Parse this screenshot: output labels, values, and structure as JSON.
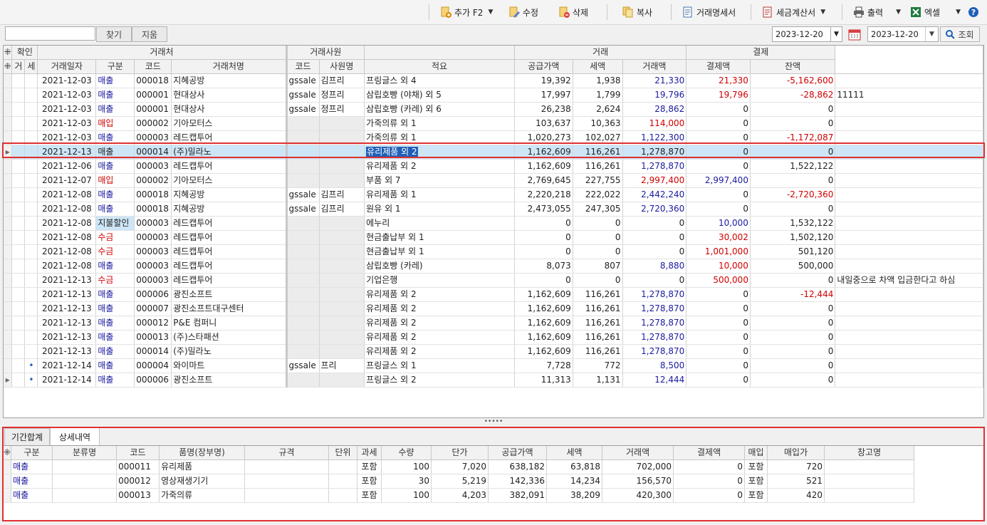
{
  "toolbar": {
    "add": "추가 F2",
    "edit": "수정",
    "delete": "삭제",
    "copy": "복사",
    "statement": "거래명세서",
    "invoice": "세금계산서",
    "print": "출력",
    "excel": "엑셀"
  },
  "search": {
    "find": "찾기",
    "clear": "지움",
    "date_from": "2023-12-20",
    "date_to": "2023-12-20",
    "query": "조회"
  },
  "grid": {
    "groups": {
      "confirm": "확인",
      "partner": "거래처",
      "staff": "거래사원",
      "trade": "거래",
      "settle": "결제"
    },
    "headers": {
      "g1": "거",
      "g2": "세",
      "date": "거래일자",
      "kind": "구분",
      "code": "코드",
      "name": "거래처명",
      "scode": "코드",
      "sname": "사원명",
      "memo": "적요",
      "supply": "공급가액",
      "tax": "세액",
      "amount": "거래액",
      "paid": "결제액",
      "balance": "잔액"
    },
    "rows": [
      {
        "m": "",
        "dot": "",
        "date": "2021-12-03",
        "kind": "매출",
        "kc": "blue",
        "code": "000018",
        "name": "지혜공방",
        "sc": "gssale",
        "sn": "김프리",
        "memo": "프링글스 외 4",
        "supply": "19,392",
        "tax": "1,938",
        "amount": "21,330",
        "paid": "21,330",
        "pc": "red",
        "bal": "-5,162,600",
        "bc": "red",
        "note": ""
      },
      {
        "m": "",
        "dot": "",
        "date": "2021-12-03",
        "kind": "매출",
        "kc": "blue",
        "code": "000001",
        "name": "현대상사",
        "sc": "gssale",
        "sn": "정프리",
        "memo": "삼립호빵 (야채) 외 5",
        "supply": "17,997",
        "tax": "1,799",
        "amount": "19,796",
        "paid": "19,796",
        "pc": "red",
        "bal": "-28,862",
        "bc": "red",
        "note": "11111"
      },
      {
        "m": "",
        "dot": "",
        "date": "2021-12-03",
        "kind": "매출",
        "kc": "blue",
        "code": "000001",
        "name": "현대상사",
        "sc": "gssale",
        "sn": "정프리",
        "memo": "삼립호빵 (카레) 외 6",
        "supply": "26,238",
        "tax": "2,624",
        "amount": "28,862",
        "paid": "0",
        "pc": "",
        "bal": "0",
        "bc": "",
        "note": ""
      },
      {
        "m": "",
        "dot": "",
        "date": "2021-12-03",
        "kind": "매입",
        "kc": "red",
        "code": "000002",
        "name": "기아모터스",
        "sc": "",
        "sn": "",
        "memo": "가죽의류 외 1",
        "supply": "103,637",
        "tax": "10,363",
        "amount": "114,000",
        "ac": "red",
        "paid": "0",
        "pc": "",
        "bal": "0",
        "bc": "",
        "note": ""
      },
      {
        "m": "",
        "dot": "",
        "date": "2021-12-03",
        "kind": "매출",
        "kc": "blue",
        "code": "000003",
        "name": "레드캡투어",
        "sc": "",
        "sn": "",
        "memo": "가죽의류 외 1",
        "supply": "1,020,273",
        "tax": "102,027",
        "amount": "1,122,300",
        "paid": "0",
        "pc": "",
        "bal": "-1,172,087",
        "bc": "red",
        "note": ""
      },
      {
        "m": "▸",
        "dot": "",
        "date": "2021-12-13",
        "kind": "매출",
        "kc": "",
        "code": "000014",
        "name": "(주)밀라노",
        "sc": "",
        "sn": "",
        "memo": "유리제품 외 2",
        "supply": "1,162,609",
        "tax": "116,261",
        "amount": "1,278,870",
        "ac": "plain",
        "paid": "0",
        "pc": "",
        "bal": "0",
        "bc": "",
        "note": "",
        "sel": true
      },
      {
        "m": "",
        "dot": "",
        "date": "2021-12-06",
        "kind": "매출",
        "kc": "blue",
        "code": "000003",
        "name": "레드캡투어",
        "sc": "",
        "sn": "",
        "memo": "유리제품 외 2",
        "supply": "1,162,609",
        "tax": "116,261",
        "amount": "1,278,870",
        "paid": "0",
        "pc": "",
        "bal": "1,522,122",
        "bc": "",
        "note": ""
      },
      {
        "m": "",
        "dot": "",
        "date": "2021-12-07",
        "kind": "매입",
        "kc": "red",
        "code": "000002",
        "name": "기아모터스",
        "sc": "",
        "sn": "",
        "memo": "부품 외 7",
        "supply": "2,769,645",
        "tax": "227,755",
        "amount": "2,997,400",
        "ac": "red",
        "paid": "2,997,400",
        "pc": "blue",
        "bal": "0",
        "bc": "",
        "note": ""
      },
      {
        "m": "",
        "dot": "",
        "date": "2021-12-08",
        "kind": "매출",
        "kc": "blue",
        "code": "000018",
        "name": "지혜공방",
        "sc": "gssale",
        "sn": "김프리",
        "memo": "유리제품 외 1",
        "supply": "2,220,218",
        "tax": "222,022",
        "amount": "2,442,240",
        "paid": "0",
        "pc": "",
        "bal": "-2,720,360",
        "bc": "red",
        "note": ""
      },
      {
        "m": "",
        "dot": "",
        "date": "2021-12-08",
        "kind": "매출",
        "kc": "blue",
        "code": "000018",
        "name": "지혜공방",
        "sc": "gssale",
        "sn": "김프리",
        "memo": "원유 외 1",
        "supply": "2,473,055",
        "tax": "247,305",
        "amount": "2,720,360",
        "paid": "0",
        "pc": "",
        "bal": "0",
        "bc": "",
        "note": ""
      },
      {
        "m": "",
        "dot": "",
        "date": "2021-12-08",
        "kind": "지불할인",
        "kc": "hl",
        "code": "000003",
        "name": "레드캡투어",
        "sc": "",
        "sn": "",
        "memo": "에누리",
        "supply": "0",
        "tax": "0",
        "amount": "0",
        "ac": "plain",
        "paid": "10,000",
        "pc": "blue",
        "bal": "1,532,122",
        "bc": "",
        "note": ""
      },
      {
        "m": "",
        "dot": "",
        "date": "2021-12-08",
        "kind": "수금",
        "kc": "red",
        "code": "000003",
        "name": "레드캡투어",
        "sc": "",
        "sn": "",
        "memo": "현금출납부 외 1",
        "supply": "0",
        "tax": "0",
        "amount": "0",
        "ac": "plain",
        "paid": "30,002",
        "pc": "red",
        "bal": "1,502,120",
        "bc": "",
        "note": ""
      },
      {
        "m": "",
        "dot": "",
        "date": "2021-12-08",
        "kind": "수금",
        "kc": "red",
        "code": "000003",
        "name": "레드캡투어",
        "sc": "",
        "sn": "",
        "memo": "현금출납부 외 1",
        "supply": "0",
        "tax": "0",
        "amount": "0",
        "ac": "plain",
        "paid": "1,001,000",
        "pc": "red",
        "bal": "501,120",
        "bc": "",
        "note": ""
      },
      {
        "m": "",
        "dot": "",
        "date": "2021-12-08",
        "kind": "매출",
        "kc": "blue",
        "code": "000003",
        "name": "레드캡투어",
        "sc": "",
        "sn": "",
        "memo": "삼립호빵 (카레)",
        "supply": "8,073",
        "tax": "807",
        "amount": "8,880",
        "paid": "10,000",
        "pc": "red",
        "bal": "500,000",
        "bc": "",
        "note": ""
      },
      {
        "m": "",
        "dot": "",
        "date": "2021-12-13",
        "kind": "수금",
        "kc": "red",
        "code": "000003",
        "name": "레드캡투어",
        "sc": "",
        "sn": "",
        "memo": "기업은행",
        "supply": "0",
        "tax": "0",
        "amount": "0",
        "ac": "plain",
        "paid": "500,000",
        "pc": "red",
        "bal": "0",
        "bc": "",
        "note": "내일중으로 차액 입금한다고 하심"
      },
      {
        "m": "",
        "dot": "",
        "date": "2021-12-13",
        "kind": "매출",
        "kc": "blue",
        "code": "000006",
        "name": "광진소프트",
        "sc": "",
        "sn": "",
        "memo": "유리제품 외 2",
        "supply": "1,162,609",
        "tax": "116,261",
        "amount": "1,278,870",
        "paid": "0",
        "pc": "",
        "bal": "-12,444",
        "bc": "red",
        "note": ""
      },
      {
        "m": "",
        "dot": "",
        "date": "2021-12-13",
        "kind": "매출",
        "kc": "blue",
        "code": "000007",
        "name": "광진소프트대구센터",
        "sc": "",
        "sn": "",
        "memo": "유리제품 외 2",
        "supply": "1,162,609",
        "tax": "116,261",
        "amount": "1,278,870",
        "paid": "0",
        "pc": "",
        "bal": "0",
        "bc": "",
        "note": ""
      },
      {
        "m": "",
        "dot": "",
        "date": "2021-12-13",
        "kind": "매출",
        "kc": "blue",
        "code": "000012",
        "name": "P&E 컴퍼니",
        "sc": "",
        "sn": "",
        "memo": "유리제품 외 2",
        "supply": "1,162,609",
        "tax": "116,261",
        "amount": "1,278,870",
        "paid": "0",
        "pc": "",
        "bal": "0",
        "bc": "",
        "note": ""
      },
      {
        "m": "",
        "dot": "",
        "date": "2021-12-13",
        "kind": "매출",
        "kc": "blue",
        "code": "000013",
        "name": "(주)스타패션",
        "sc": "",
        "sn": "",
        "memo": "유리제품 외 2",
        "supply": "1,162,609",
        "tax": "116,261",
        "amount": "1,278,870",
        "paid": "0",
        "pc": "",
        "bal": "0",
        "bc": "",
        "note": ""
      },
      {
        "m": "",
        "dot": "",
        "date": "2021-12-13",
        "kind": "매출",
        "kc": "blue",
        "code": "000014",
        "name": "(주)밀라노",
        "sc": "",
        "sn": "",
        "memo": "유리제품 외 2",
        "supply": "1,162,609",
        "tax": "116,261",
        "amount": "1,278,870",
        "paid": "0",
        "pc": "",
        "bal": "0",
        "bc": "",
        "note": ""
      },
      {
        "m": "",
        "dot": "•",
        "date": "2021-12-14",
        "kind": "매출",
        "kc": "blue",
        "code": "000004",
        "name": "와이마트",
        "sc": "gssale",
        "sn": "프리",
        "memo": "프링글스 외 1",
        "supply": "7,728",
        "tax": "772",
        "amount": "8,500",
        "paid": "0",
        "pc": "",
        "bal": "0",
        "bc": "",
        "note": ""
      },
      {
        "m": "▸",
        "dot": "•",
        "date": "2021-12-14",
        "kind": "매출",
        "kc": "blue",
        "code": "000006",
        "name": "광진소프트",
        "sc": "",
        "sn": "",
        "memo": "프링글스 외 2",
        "supply": "11,313",
        "tax": "1,131",
        "amount": "12,444",
        "paid": "0",
        "pc": "",
        "bal": "0",
        "bc": "",
        "note": ""
      }
    ]
  },
  "bottom": {
    "tabs": [
      "기간합계",
      "상세내역"
    ],
    "headers": {
      "kind": "구분",
      "cat": "분류명",
      "code": "코드",
      "item": "품명(장부명)",
      "spec": "규격",
      "unit": "단위",
      "taxable": "과세",
      "qty": "수량",
      "price": "단가",
      "supply": "공급가액",
      "tax": "세액",
      "amount": "거래액",
      "paid": "결제액",
      "buy": "매입",
      "buyprice": "매입가",
      "wh": "창고명"
    },
    "rows": [
      {
        "kind": "매출",
        "cat": "",
        "code": "000011",
        "item": "유리제품",
        "spec": "",
        "unit": "",
        "taxable": "포함",
        "qty": "100",
        "price": "7,020",
        "supply": "638,182",
        "tax": "63,818",
        "amount": "702,000",
        "paid": "0",
        "buy": "포함",
        "buyprice": "720",
        "wh": ""
      },
      {
        "kind": "매출",
        "cat": "",
        "code": "000012",
        "item": "영상재생기기",
        "spec": "",
        "unit": "",
        "taxable": "포함",
        "qty": "30",
        "price": "5,219",
        "supply": "142,336",
        "tax": "14,234",
        "amount": "156,570",
        "paid": "0",
        "buy": "포함",
        "buyprice": "521",
        "wh": ""
      },
      {
        "kind": "매출",
        "cat": "",
        "code": "000013",
        "item": "가죽의류",
        "spec": "",
        "unit": "",
        "taxable": "포함",
        "qty": "100",
        "price": "4,203",
        "supply": "382,091",
        "tax": "38,209",
        "amount": "420,300",
        "paid": "0",
        "buy": "포함",
        "buyprice": "420",
        "wh": ""
      }
    ]
  },
  "colors": {
    "blue": "#1a1aa0",
    "red": "#d00000",
    "select": "#cde6f7",
    "highlight": "#e03030"
  }
}
